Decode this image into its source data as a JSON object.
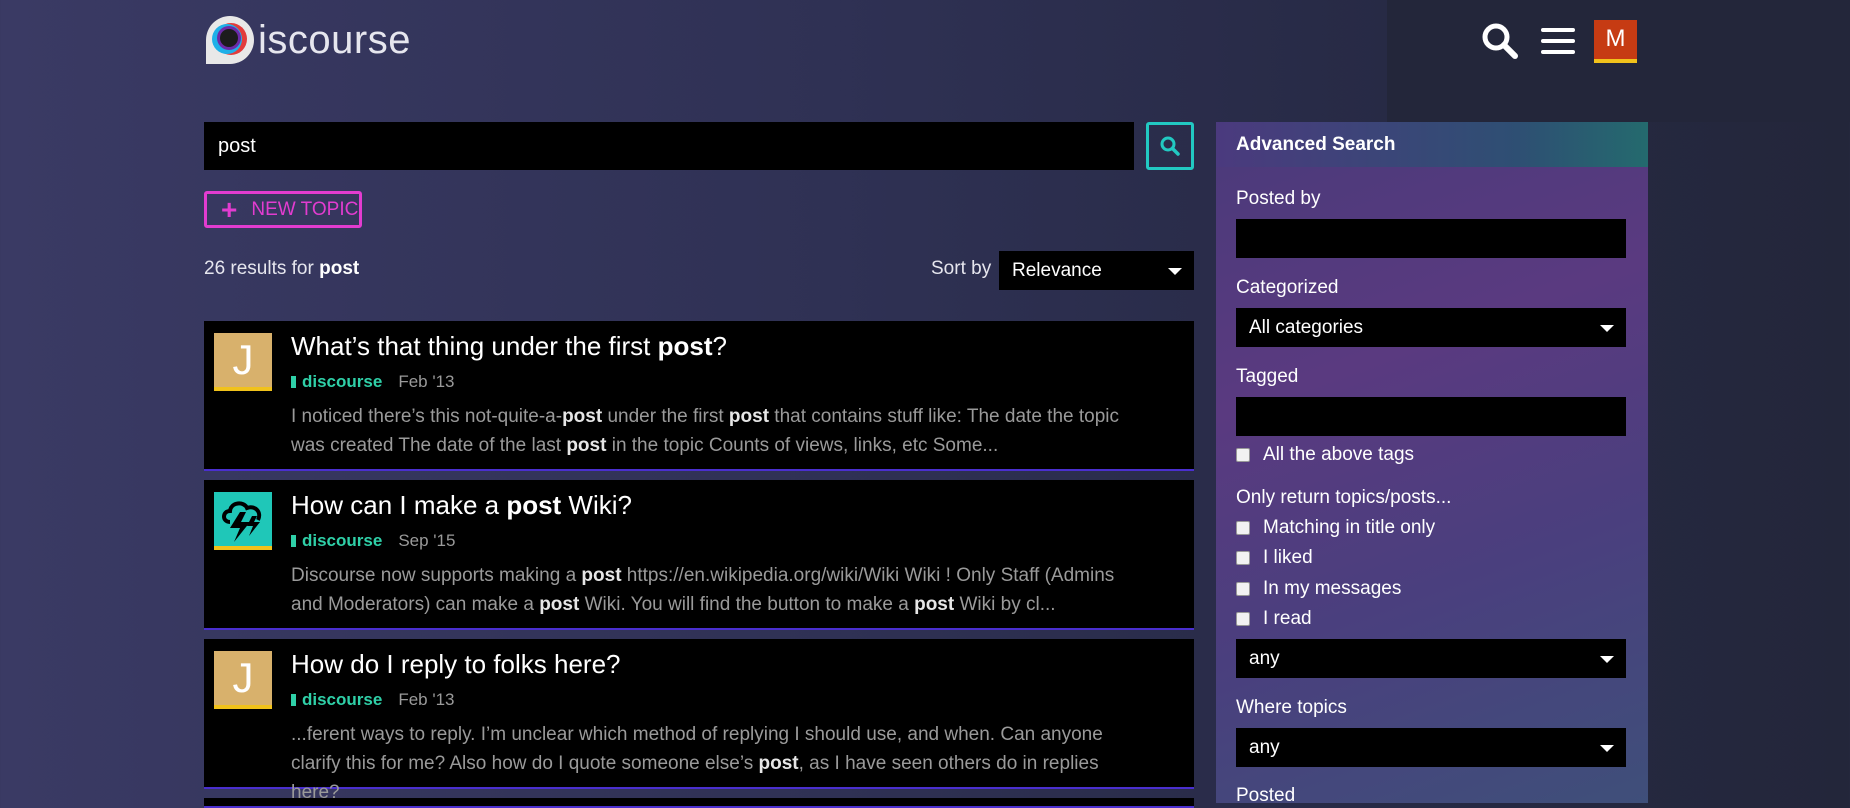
{
  "header": {
    "logo_text": "iscourse",
    "search_icon": "search-icon",
    "menu_icon": "hamburger-menu-icon",
    "user_avatar_letter": "M"
  },
  "search": {
    "query": "post",
    "button_icon": "search-icon"
  },
  "new_topic_label": "NEW TOPIC",
  "results_summary": {
    "count_text": "26 results for",
    "term": "post"
  },
  "sort": {
    "label": "Sort by",
    "value": "Relevance"
  },
  "results": [
    {
      "avatar_letter": "J",
      "title_pre": "What’s that thing under the first ",
      "title_bold": "post",
      "title_post": "?",
      "category": "discourse",
      "date": "Feb '13",
      "blurb": [
        {
          "t": "I noticed there’s this not-quite-a-",
          "b": false
        },
        {
          "t": "post",
          "b": true
        },
        {
          "t": " under the first ",
          "b": false
        },
        {
          "t": "post",
          "b": true
        },
        {
          "t": " that contains stuff like: The date the topic was created The date of the last ",
          "b": false
        },
        {
          "t": "post",
          "b": true
        },
        {
          "t": " in the topic Counts of views, links, etc Some...",
          "b": false
        }
      ]
    },
    {
      "avatar_letter": "",
      "title_pre": "How can I make a ",
      "title_bold": "post",
      "title_post": " Wiki?",
      "category": "discourse",
      "date": "Sep '15",
      "blurb": [
        {
          "t": "Discourse now supports making a ",
          "b": false
        },
        {
          "t": "post",
          "b": true
        },
        {
          "t": " https://en.wikipedia.org/wiki/Wiki Wiki ! Only Staff (Admins and Moderators) can make a ",
          "b": false
        },
        {
          "t": "post",
          "b": true
        },
        {
          "t": " Wiki. You will find the button to make a ",
          "b": false
        },
        {
          "t": "post",
          "b": true
        },
        {
          "t": " Wiki by cl...",
          "b": false
        }
      ]
    },
    {
      "avatar_letter": "J",
      "title_pre": "How do I reply to folks here?",
      "title_bold": "",
      "title_post": "",
      "category": "discourse",
      "date": "Feb '13",
      "blurb": [
        {
          "t": "...ferent ways to reply. I’m unclear which method of replying I should use, and when. Can anyone clarify this for me? Also how do I quote someone else’s ",
          "b": false
        },
        {
          "t": "post",
          "b": true
        },
        {
          "t": ", as I have seen others do in replies here?",
          "b": false
        }
      ]
    }
  ],
  "advanced": {
    "heading": "Advanced Search",
    "posted_by_label": "Posted by",
    "categorized_label": "Categorized",
    "categorized_value": "All categories",
    "tagged_label": "Tagged",
    "all_tags_label": "All the above tags",
    "only_return_label": "Only return topics/posts...",
    "options": [
      "Matching in title only",
      "I liked",
      "In my messages",
      "I read"
    ],
    "only_return_value": "any",
    "where_topics_label": "Where topics",
    "where_topics_value": "any",
    "posted_label": "Posted"
  },
  "colors": {
    "accent_teal": "#22c9c2",
    "accent_magenta": "#e23cd0",
    "category_green": "#2fd0a8",
    "avatar_orange": "#c63b13"
  }
}
